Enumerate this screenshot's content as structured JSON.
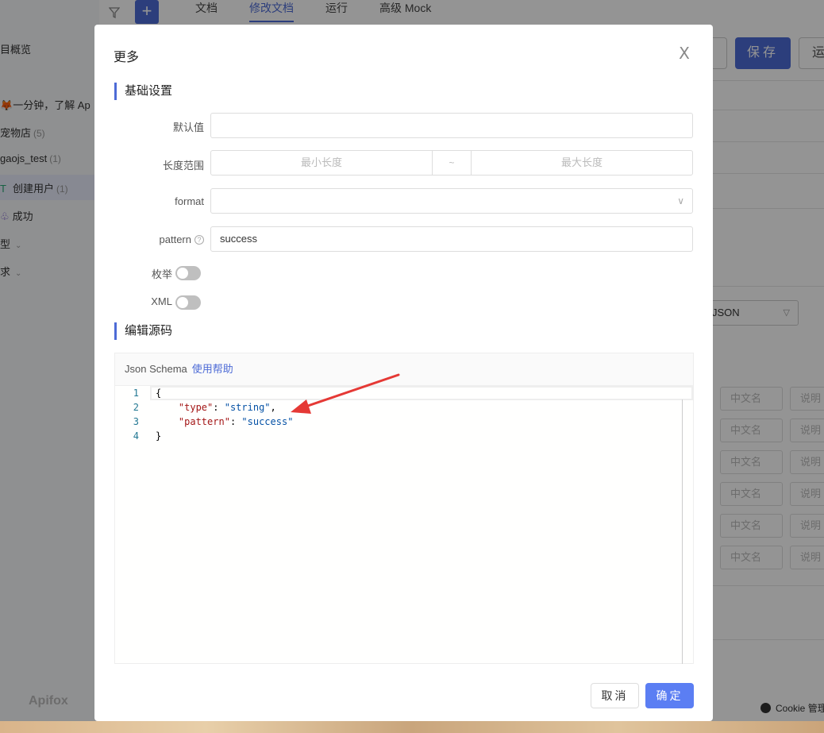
{
  "app": {
    "tabs": [
      "文档",
      "修改文档",
      "运行",
      "高级 Mock"
    ],
    "active_tab": "修改文档",
    "save_label": "保存",
    "run_label": "运",
    "logo_text": "Apifox",
    "cookie_label": "Cookie 管理",
    "json_select": "JSON",
    "sidebar": {
      "overview": "目概览",
      "item1": "一分钟，了解 Ap",
      "item2_label": "宠物店",
      "item2_count": "(5)",
      "item3_label": "gaojs_test",
      "item3_count": "(1)",
      "item4_method": "T",
      "item4_label": "创建用户",
      "item4_count": "(1)",
      "item5_label": "成功",
      "item6_label": "型",
      "item7_label": "求"
    },
    "table_cells": {
      "cn_name": "中文名",
      "desc": "说明"
    }
  },
  "modal": {
    "title": "更多",
    "close": "X",
    "section_basic": "基础设置",
    "label_default": "默认值",
    "label_length": "长度范围",
    "min_placeholder": "最小长度",
    "range_sep": "~",
    "max_placeholder": "最大长度",
    "label_format": "format",
    "label_pattern": "pattern",
    "pattern_value": "success",
    "label_enum": "枚举",
    "label_xml": "XML",
    "section_source": "编辑源码",
    "editor_title": "Json Schema",
    "editor_help": "使用帮助",
    "line_numbers": [
      "1",
      "2",
      "3",
      "4"
    ],
    "code": {
      "l1": "{",
      "l2_key": "\"type\"",
      "l2_val": "\"string\"",
      "l3_key": "\"pattern\"",
      "l3_val": "\"success\"",
      "l4": "}"
    },
    "cancel_label": "取消",
    "ok_label": "确定"
  },
  "colors": {
    "accent": "#4d6bd6",
    "ok_button": "#5b7ef3",
    "arrow": "#e53935"
  }
}
